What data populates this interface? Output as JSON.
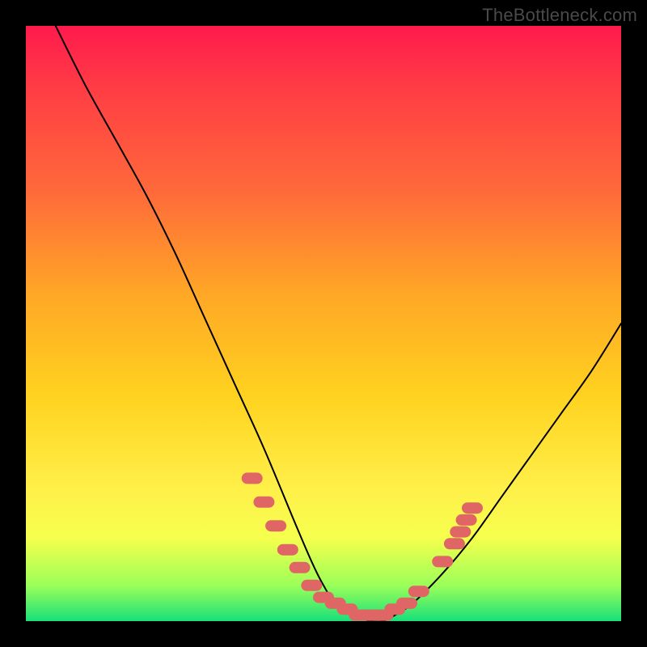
{
  "watermark": {
    "text": "TheBottleneck.com"
  },
  "chart_data": {
    "type": "line",
    "title": "",
    "xlabel": "",
    "ylabel": "",
    "xlim": [
      0,
      100
    ],
    "ylim": [
      0,
      100
    ],
    "grid": false,
    "legend": false,
    "series": [
      {
        "name": "bottleneck-curve",
        "x": [
          5,
          10,
          15,
          20,
          25,
          30,
          35,
          40,
          45,
          48,
          50,
          52,
          55,
          58,
          60,
          62,
          65,
          70,
          75,
          80,
          85,
          90,
          95,
          100
        ],
        "y": [
          100,
          90,
          81,
          72,
          62,
          51,
          40,
          29,
          17,
          10,
          6,
          3,
          1,
          0,
          0,
          1,
          3,
          8,
          14,
          21,
          28,
          35,
          42,
          50
        ]
      }
    ],
    "highlight_points": {
      "name": "measured-samples",
      "color": "#e06666",
      "points": [
        {
          "x": 38,
          "y": 24
        },
        {
          "x": 40,
          "y": 20
        },
        {
          "x": 42,
          "y": 16
        },
        {
          "x": 44,
          "y": 12
        },
        {
          "x": 46,
          "y": 9
        },
        {
          "x": 48,
          "y": 6
        },
        {
          "x": 50,
          "y": 4
        },
        {
          "x": 52,
          "y": 3
        },
        {
          "x": 54,
          "y": 2
        },
        {
          "x": 56,
          "y": 1
        },
        {
          "x": 58,
          "y": 1
        },
        {
          "x": 60,
          "y": 1
        },
        {
          "x": 62,
          "y": 2
        },
        {
          "x": 64,
          "y": 3
        },
        {
          "x": 66,
          "y": 5
        },
        {
          "x": 70,
          "y": 10
        },
        {
          "x": 72,
          "y": 13
        },
        {
          "x": 73,
          "y": 15
        },
        {
          "x": 74,
          "y": 17
        },
        {
          "x": 75,
          "y": 19
        }
      ]
    },
    "gradient_stops": [
      {
        "pos": 0,
        "color": "#ff1a4d"
      },
      {
        "pos": 45,
        "color": "#ffa726"
      },
      {
        "pos": 78,
        "color": "#fff04a"
      },
      {
        "pos": 100,
        "color": "#18e07a"
      }
    ]
  }
}
